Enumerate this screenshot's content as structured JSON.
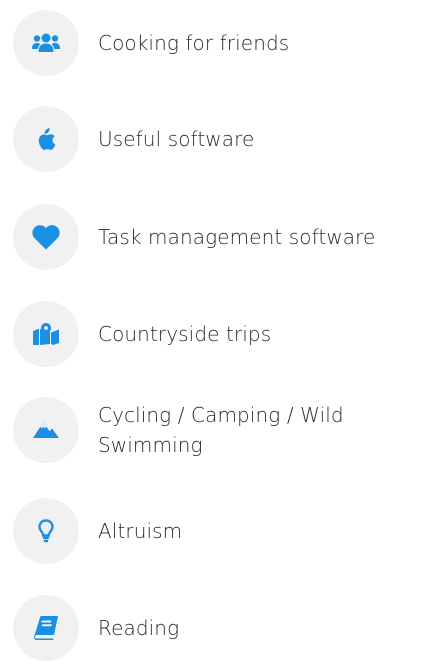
{
  "accent_color": "#1a8fe3",
  "icon_bg_color": "#f1f1f1",
  "interests": [
    {
      "label": "Cooking for friends",
      "icon": "users-icon"
    },
    {
      "label": "Useful software",
      "icon": "apple-icon"
    },
    {
      "label": "Task management software",
      "icon": "heart-icon"
    },
    {
      "label": "Countryside trips",
      "icon": "map-pin-icon"
    },
    {
      "label": "Cycling / Camping / Wild Swimming",
      "icon": "mountain-icon"
    },
    {
      "label": "Altruism",
      "icon": "lightbulb-icon"
    },
    {
      "label": "Reading",
      "icon": "book-icon"
    }
  ]
}
